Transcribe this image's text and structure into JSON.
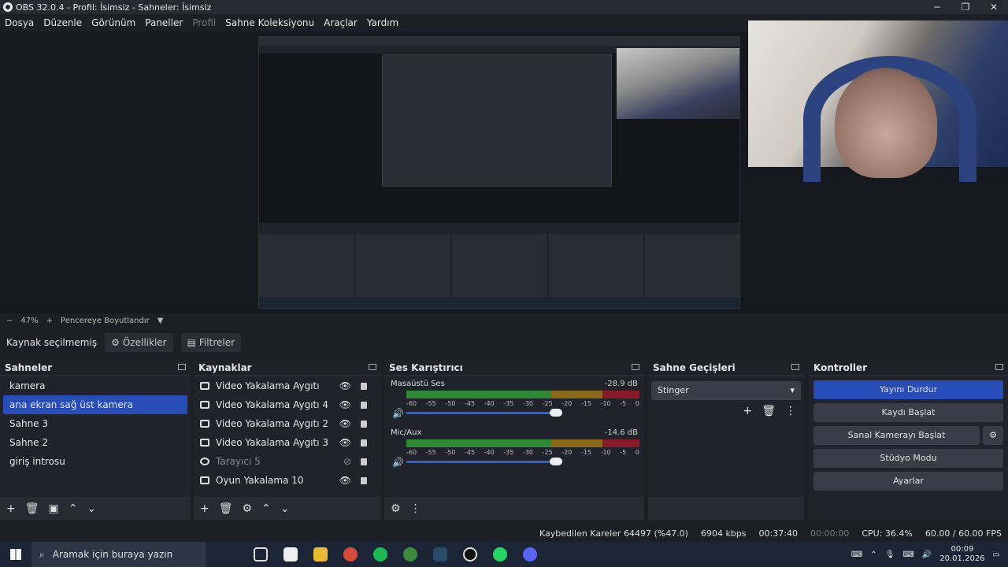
{
  "window": {
    "title": "OBS 32.0.4 - Profil: İsimsiz - Sahneler: İsimsiz",
    "min": "─",
    "max": "❐",
    "close": "✕"
  },
  "menu": [
    "Dosya",
    "Düzenle",
    "Görünüm",
    "Paneller",
    "Profil",
    "Sahne Koleksiyonu",
    "Araçlar",
    "Yardım"
  ],
  "zoom": {
    "minus": "−",
    "value": "47%",
    "plus": "+",
    "fit_label": "Pencereye Boyutlandır",
    "caret": "▼"
  },
  "source_bar": {
    "status": "Kaynak seçilmemiş",
    "properties": "Özellikler",
    "filters": "Filtreler"
  },
  "scenes": {
    "title": "Sahneler",
    "items": [
      "kamera",
      "ana ekran sağ üst  kamera",
      "Sahne 3",
      "Sahne 2",
      "giriş introsu"
    ],
    "selected_index": 1
  },
  "sources": {
    "title": "Kaynaklar",
    "items": [
      {
        "label": "Video Yakalama Aygıtı",
        "visible": true,
        "dim": false
      },
      {
        "label": "Video Yakalama Aygıtı 4",
        "visible": true,
        "dim": false
      },
      {
        "label": "Video Yakalama Aygıtı 2",
        "visible": true,
        "dim": false
      },
      {
        "label": "Video Yakalama Aygıtı 3",
        "visible": true,
        "dim": false
      },
      {
        "label": "Tarayıcı 5",
        "visible": false,
        "dim": true
      },
      {
        "label": "Oyun Yakalama 10",
        "visible": true,
        "dim": false
      }
    ]
  },
  "mixer": {
    "title": "Ses Karıştırıcı",
    "channels": [
      {
        "name": "Masaüstü Ses",
        "db": "-28.9 dB",
        "level": 0.32,
        "volume": 0.9
      },
      {
        "name": "Mic/Aux",
        "db": "-14.6 dB",
        "level": 0.72,
        "volume": 0.95
      }
    ],
    "ticks": [
      "-60",
      "-55",
      "-50",
      "-45",
      "-40",
      "-35",
      "-30",
      "-25",
      "-20",
      "-15",
      "-10",
      "-5",
      "0"
    ]
  },
  "transitions": {
    "title": "Sahne Geçişleri",
    "selected": "Stinger"
  },
  "controls": {
    "title": "Kontroller",
    "stop_stream": "Yayını Durdur",
    "start_record": "Kaydı Başlat",
    "start_vcam": "Sanal Kamerayı Başlat",
    "studio_mode": "Stüdyo Modu",
    "settings": "Ayarlar"
  },
  "status": {
    "dropped": "Kaybedilen Kareler 64497 (%47.0)",
    "bitrate": "6904 kbps",
    "stream_time": "00:37:40",
    "record_time": "00:00:00",
    "cpu": "CPU: 36.4%",
    "fps": "60.00 / 60.00 FPS"
  },
  "taskbar": {
    "search_placeholder": "Aramak için buraya yazın",
    "time": "00:09",
    "date": "20.01.2026"
  },
  "colors": {
    "accent": "#284cb8",
    "meter_green": "#2e8a34",
    "meter_yellow": "#8a6a1a",
    "meter_red": "#8a1a2a"
  }
}
